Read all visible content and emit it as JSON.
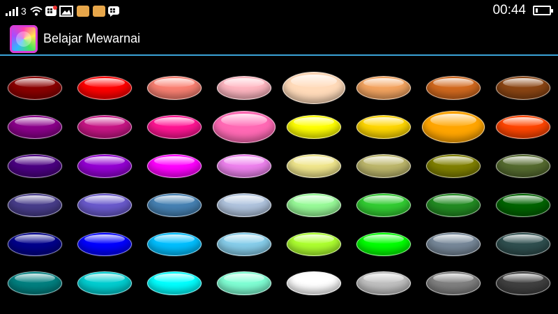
{
  "status_bar": {
    "network_type": "3",
    "time": "00:44",
    "battery_level": 0.15,
    "icons": [
      "signal-icon",
      "wifi-icon",
      "bbm-notification-icon",
      "image-icon",
      "game-notification-icon",
      "game-notification-icon",
      "bbm-icon",
      "battery-icon"
    ]
  },
  "action_bar": {
    "title": "Belajar Mewarnai",
    "icon": "app-icon",
    "divider_color": "#3aa3d8"
  },
  "palette": {
    "selected": [
      "#ffdab9",
      "#ff69b4",
      "#ffa500"
    ],
    "rows": [
      [
        "#8b0000",
        "#ff0000",
        "#fa8072",
        "#ffb6c1",
        "#ffdab9",
        "#f4a460",
        "#d2691e",
        "#8b4513"
      ],
      [
        "#8b008b",
        "#c71585",
        "#ff1493",
        "#ff69b4",
        "#ffff00",
        "#ffd700",
        "#ffa500",
        "#ff4500"
      ],
      [
        "#4b0082",
        "#9400d3",
        "#ff00ff",
        "#ee82ee",
        "#f0e68c",
        "#bdb76b",
        "#808000",
        "#556b2f"
      ],
      [
        "#483d8b",
        "#6a5acd",
        "#4682b4",
        "#b0c4de",
        "#98fb98",
        "#32cd32",
        "#228b22",
        "#006400"
      ],
      [
        "#00008b",
        "#0000ff",
        "#00bfff",
        "#87ceeb",
        "#adff2f",
        "#00ff00",
        "#778899",
        "#2f4f4f"
      ],
      [
        "#008080",
        "#00ced1",
        "#00ffff",
        "#7fffd4",
        "#ffffff",
        "#c0c0c0",
        "#808080",
        "#404040"
      ]
    ]
  }
}
